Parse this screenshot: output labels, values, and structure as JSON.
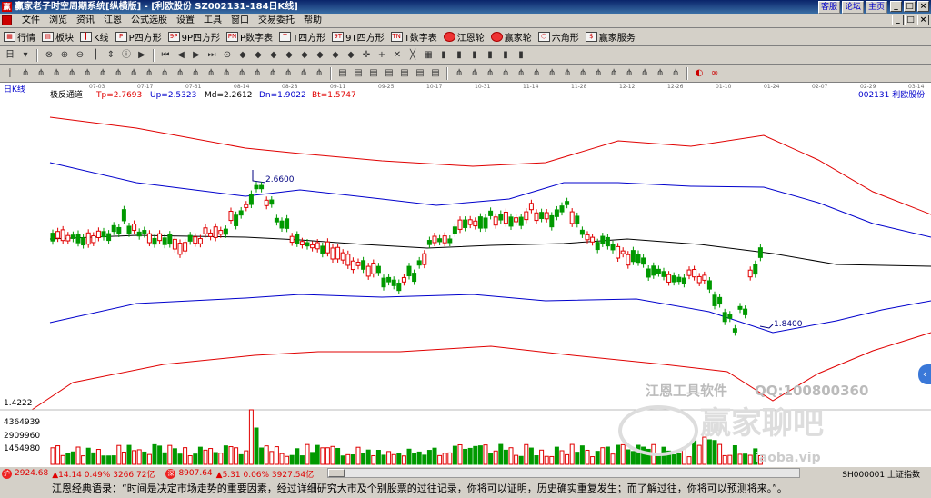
{
  "window": {
    "app_title": "赢家老子时空周期系统[纵横版] - [利欧股份  SZ002131-184日K线]",
    "links": [
      "客服",
      "论坛",
      "主页"
    ],
    "buttons": {
      "min": "_",
      "max": "□",
      "close": "×"
    }
  },
  "menu": [
    "文件",
    "浏览",
    "资讯",
    "江恩",
    "公式选股",
    "设置",
    "工具",
    "窗口",
    "交易委托",
    "帮助"
  ],
  "toolbar1": [
    {
      "label": "行情",
      "icon": "grid-icon"
    },
    {
      "label": "板块",
      "icon": "blocks-icon"
    },
    {
      "label": "K线",
      "icon": "candle-icon"
    },
    {
      "label": "P四方形",
      "icon": "square-icon",
      "glyph": "P"
    },
    {
      "label": "9P四方形",
      "icon": "square-icon",
      "glyph": "9P"
    },
    {
      "label": "P数字表",
      "icon": "table-icon",
      "glyph": "PN"
    },
    {
      "label": "T四方形",
      "icon": "square-icon",
      "glyph": "T"
    },
    {
      "label": "9T四方形",
      "icon": "square-icon",
      "glyph": "9T"
    },
    {
      "label": "T数字表",
      "icon": "table-icon",
      "glyph": "TN"
    },
    {
      "label": "江恩轮",
      "icon": "wheel-icon"
    },
    {
      "label": "赢家轮",
      "icon": "wheel-icon"
    },
    {
      "label": "六角形",
      "icon": "hexagon-icon"
    },
    {
      "label": "赢家服务",
      "icon": "service-icon"
    }
  ],
  "toolbar2_first_label": "日",
  "chart": {
    "period_label": "日K线",
    "indicator": {
      "name": "极反通道",
      "tp": "Tp=2.7693",
      "up": "Up=2.5323",
      "md": "Md=2.2612",
      "dn": "Dn=1.9022",
      "bt": "Bt=1.5747"
    },
    "stock": "002131  利欧股份",
    "high_mark": "2.6600",
    "low_mark": "1.8400",
    "price_axis_label": "1.4222",
    "volume_axis": [
      "4364939",
      "2909960",
      "1454980"
    ],
    "date_labels": [
      "07-03",
      "07-17",
      "07-31",
      "08-14",
      "08-28",
      "09-11",
      "09-25",
      "10-17",
      "10-31",
      "11-14",
      "11-28",
      "12-12",
      "12-26",
      "01-10",
      "01-24",
      "02-07",
      "02-29",
      "03-14",
      "03-28"
    ],
    "watermark": {
      "company": "江恩工具软件",
      "qq": "QQ:100800360",
      "forum": "赢家聊吧",
      "site": "iaoba.vip"
    }
  },
  "status": {
    "sh": "2924.68",
    "sh_chg": "▲14.14 0.49% 3266.72亿",
    "sz": "8907.64",
    "sz_chg": "▲5.31 0.06% 3927.54亿",
    "right": "SH000001 上证指数"
  },
  "quote": "江恩经典语录：“时间是决定市场走势的重要因素，经过详细研究大市及个别股票的过往记录，你将可以证明，历史确实重复发生；而了解过往，你将可以预测将来。”。",
  "colors": {
    "red_channel": "#e00000",
    "blue_channel": "#0000cc",
    "up_candle": "#e00000",
    "down_candle": "#009900"
  }
}
